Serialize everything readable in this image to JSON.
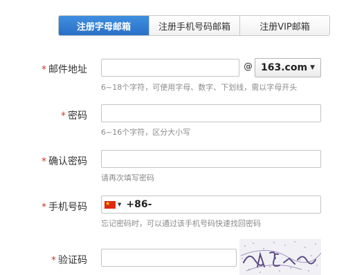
{
  "tabs": [
    {
      "label": "注册字母邮箱",
      "active": true
    },
    {
      "label": "注册手机号码邮箱",
      "active": false
    },
    {
      "label": "注册VIP邮箱",
      "active": false
    }
  ],
  "required_mark": "*",
  "email": {
    "label": "邮件地址",
    "value": "",
    "at_symbol": "@",
    "domain": "163.com",
    "hint": "6~18个字符，可使用字母、数字、下划线，需以字母开头"
  },
  "password": {
    "label": "密码",
    "value": "",
    "hint": "6~16个字符，区分大小写"
  },
  "confirm": {
    "label": "确认密码",
    "value": "",
    "hint": "请再次填写密码"
  },
  "phone": {
    "label": "手机号码",
    "flag_icon": "china-flag-icon",
    "prefix": "+86-",
    "hint": "忘记密码时，可以通过该手机号码快速找回密码"
  },
  "captcha": {
    "label": "验证码",
    "value": "",
    "image_icon": "captcha-image"
  },
  "colors": {
    "active_tab": "#2f7bd3",
    "required": "#d23a2a",
    "hint": "#8a8a8a"
  }
}
